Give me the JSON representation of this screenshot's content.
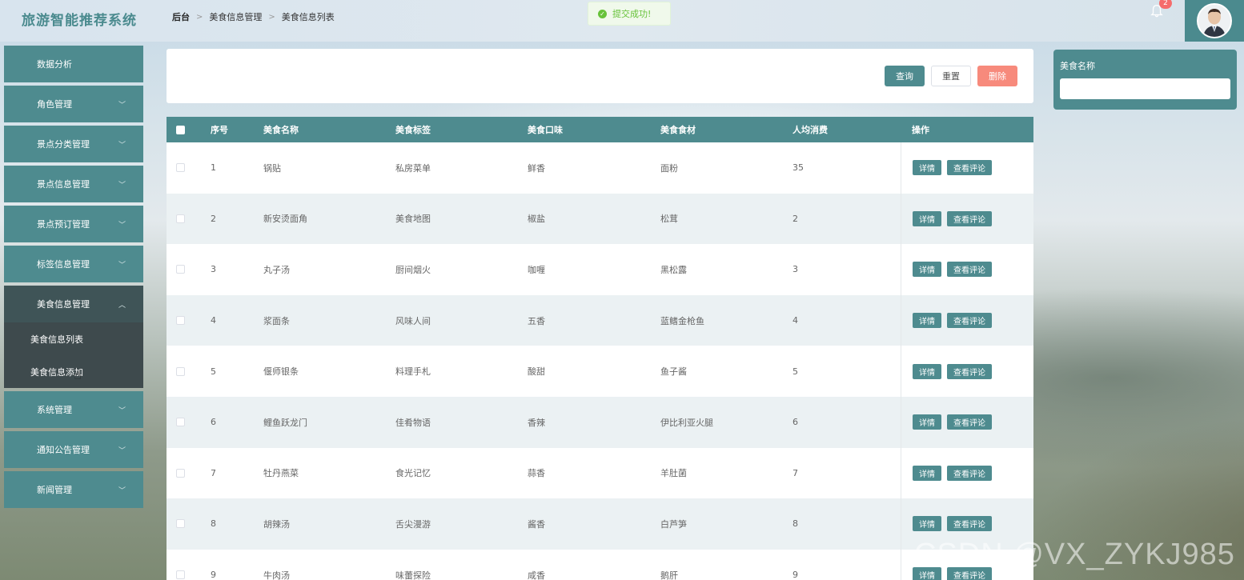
{
  "header": {
    "app_title": "旅游智能推荐系统",
    "breadcrumb": [
      "后台",
      "美食信息管理",
      "美食信息列表"
    ],
    "toast": "提交成功!",
    "notification_count": "2"
  },
  "sidebar": {
    "items": [
      {
        "label": "数据分析",
        "chevron": ""
      },
      {
        "label": "角色管理",
        "chevron": "﹀"
      },
      {
        "label": "景点分类管理",
        "chevron": "﹀"
      },
      {
        "label": "景点信息管理",
        "chevron": "﹀"
      },
      {
        "label": "景点预订管理",
        "chevron": "﹀"
      },
      {
        "label": "标签信息管理",
        "chevron": "﹀"
      },
      {
        "label": "美食信息管理",
        "chevron": "︿",
        "open": true,
        "children": [
          "美食信息列表",
          "美食信息添加"
        ]
      },
      {
        "label": "系统管理",
        "chevron": "﹀"
      },
      {
        "label": "通知公告管理",
        "chevron": "﹀"
      },
      {
        "label": "新闻管理",
        "chevron": "﹀"
      }
    ]
  },
  "actions": {
    "query": "查询",
    "reset": "重置",
    "delete": "删除"
  },
  "filter": {
    "label": "美食名称",
    "value": ""
  },
  "table": {
    "headers": [
      "序号",
      "美食名称",
      "美食标签",
      "美食口味",
      "美食食材",
      "人均消费",
      "操作"
    ],
    "op_detail": "详情",
    "op_comments": "查看评论",
    "rows": [
      [
        "1",
        "锅贴",
        "私房菜单",
        "鲜香",
        "面粉",
        "35"
      ],
      [
        "2",
        "新安烫面角",
        "美食地图",
        "椒盐",
        "松茸",
        "2"
      ],
      [
        "3",
        "丸子汤",
        "厨间烟火",
        "咖喱",
        "黑松露",
        "3"
      ],
      [
        "4",
        "浆面条",
        "风味人间",
        "五香",
        "蓝鳍金枪鱼",
        "4"
      ],
      [
        "5",
        "偃师银条",
        "料理手札",
        "酸甜",
        "鱼子酱",
        "5"
      ],
      [
        "6",
        "鲤鱼跃龙门",
        "佳肴物语",
        "香辣",
        "伊比利亚火腿",
        "6"
      ],
      [
        "7",
        "牡丹燕菜",
        "食光记忆",
        "蒜香",
        "羊肚菌",
        "7"
      ],
      [
        "8",
        "胡辣汤",
        "舌尖漫游",
        "酱香",
        "白芦笋",
        "8"
      ],
      [
        "9",
        "牛肉汤",
        "味蕾探险",
        "咸香",
        "鹅肝",
        "9"
      ]
    ]
  },
  "watermark": "CSDN @VX_ZYKJ985"
}
